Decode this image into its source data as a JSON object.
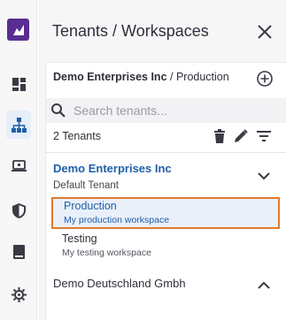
{
  "rail": {
    "items": [
      {
        "name": "dashboard"
      },
      {
        "name": "tenants"
      },
      {
        "name": "devices"
      },
      {
        "name": "security"
      },
      {
        "name": "docs"
      },
      {
        "name": "settings"
      }
    ],
    "accent": "#5a2d91",
    "active_color": "#1f5fa8"
  },
  "panel": {
    "title": "Tenants / Workspaces",
    "breadcrumb": {
      "tenant": "Demo Enterprises Inc",
      "separator": " / ",
      "workspace": "Production"
    },
    "search": {
      "placeholder": "Search tenants...",
      "value": ""
    },
    "count_label": "2 Tenants",
    "tenants": [
      {
        "name": "Demo Enterprises Inc",
        "subtitle": "Default Tenant",
        "expanded": true,
        "workspaces": [
          {
            "name": "Production",
            "description": "My production workspace",
            "selected": true
          },
          {
            "name": "Testing",
            "description": "My testing workspace",
            "selected": false
          }
        ]
      },
      {
        "name": "Demo Deutschland Gmbh",
        "expanded": false
      }
    ]
  },
  "colors": {
    "link_blue": "#1f5fa8",
    "selection_border": "#e07a2d",
    "selection_bg": "#e9f0fa"
  }
}
